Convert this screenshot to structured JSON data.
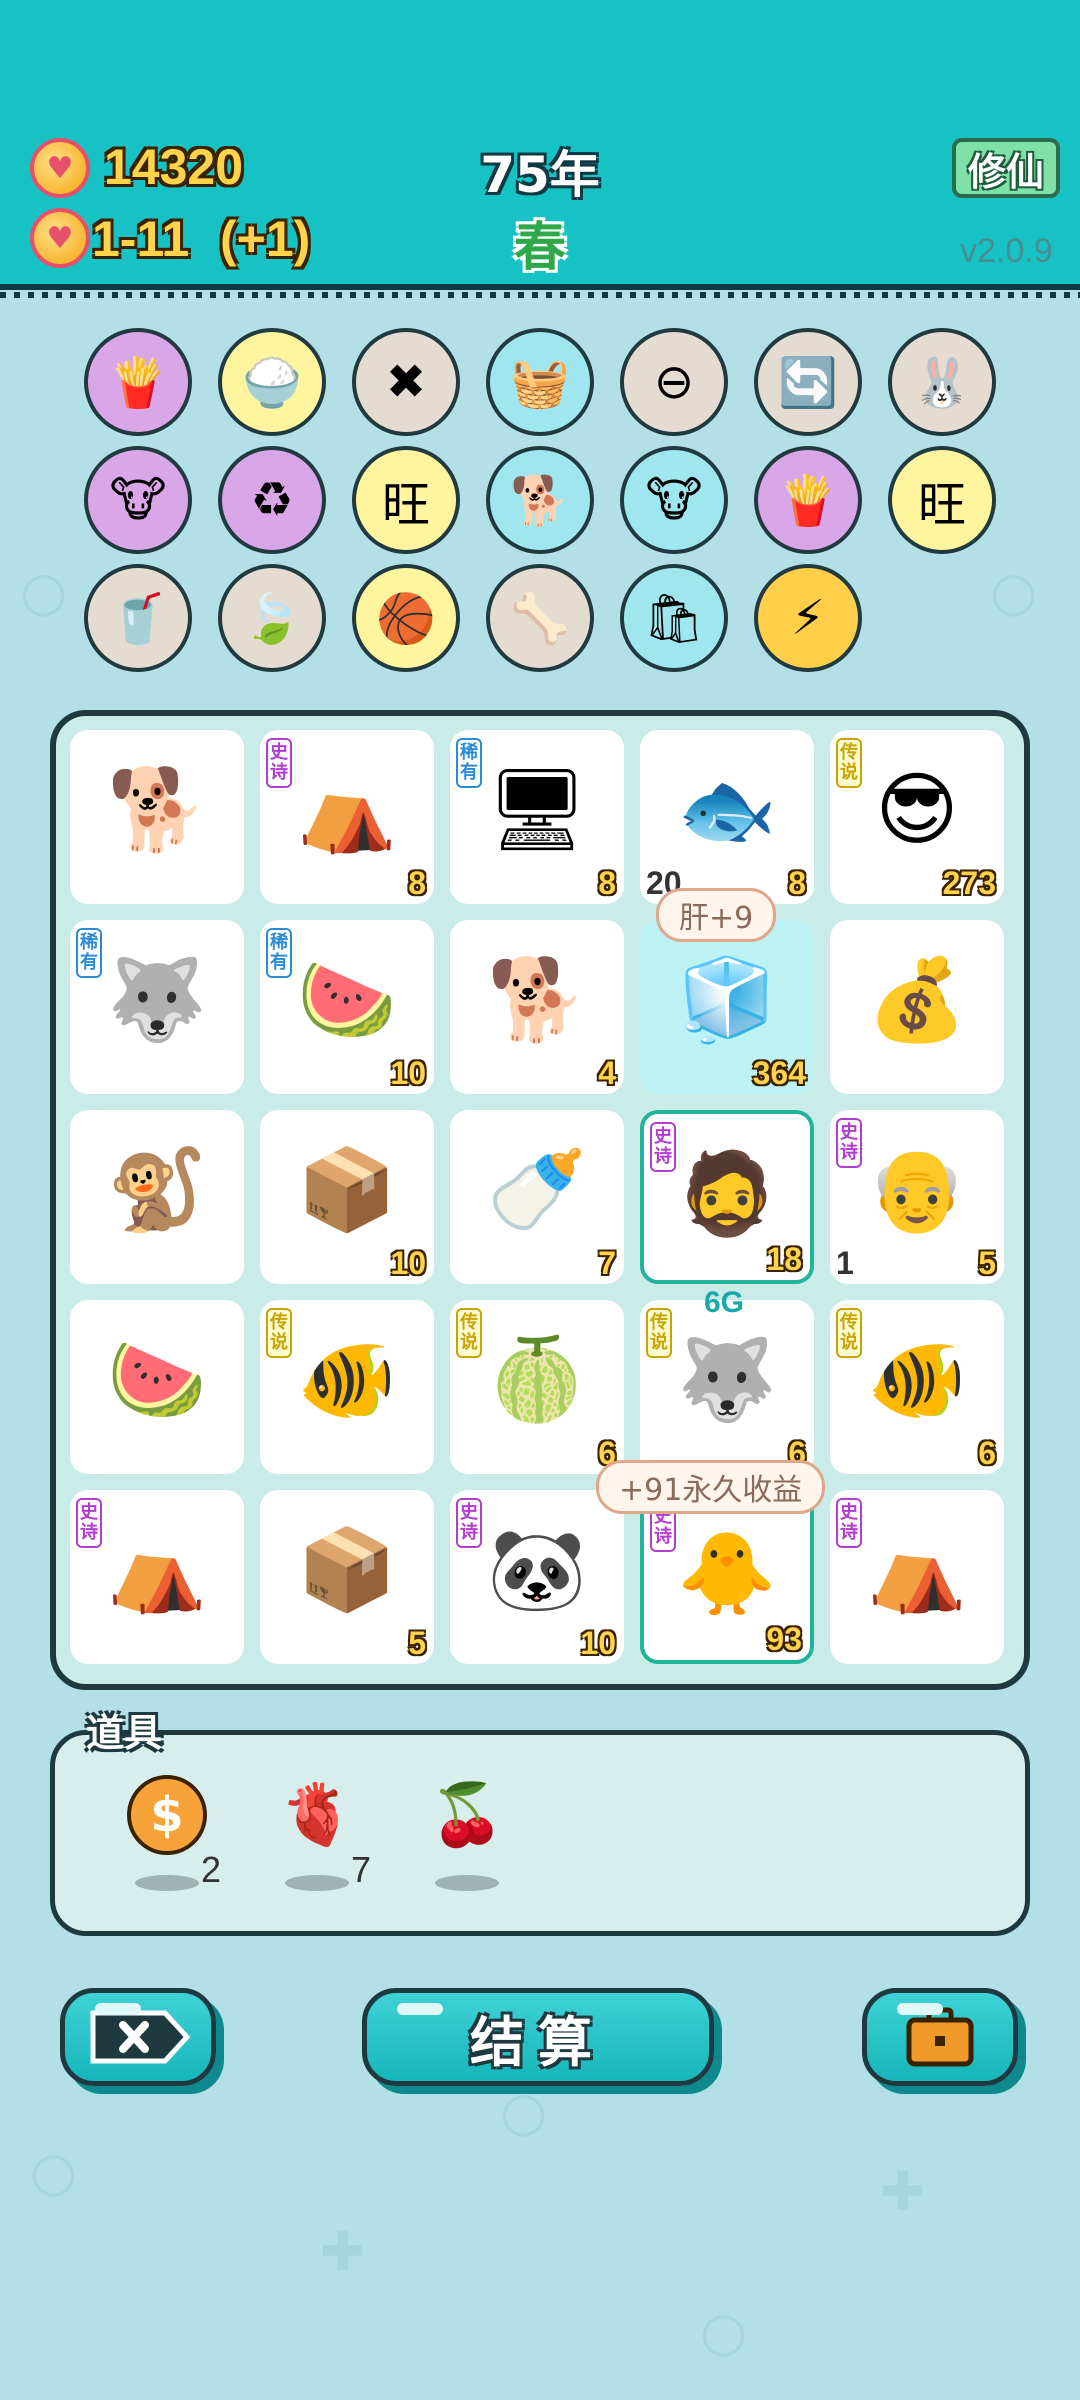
{
  "header": {
    "coins": "14320",
    "income": "1-11",
    "income_delta": "(+1)",
    "year": "75年",
    "season": "春",
    "xiuxian_label": "修仙",
    "version": "v2.0.9"
  },
  "skills": [
    {
      "icon": "fries-icon",
      "glyph": "🍟",
      "color": "purple"
    },
    {
      "icon": "rice-bowl-icon",
      "glyph": "🍚",
      "color": "yellow"
    },
    {
      "icon": "delete-tag-icon",
      "glyph": "✖",
      "color": "grey"
    },
    {
      "icon": "fruit-basket-icon",
      "glyph": "🧺",
      "color": "cyan"
    },
    {
      "icon": "minus-circle-icon",
      "glyph": "⊖",
      "color": "grey"
    },
    {
      "icon": "refresh-icon",
      "glyph": "🔄",
      "color": "grey"
    },
    {
      "icon": "rabbit-icon",
      "glyph": "🐰",
      "color": "grey"
    },
    {
      "icon": "twin-cow-icon",
      "glyph": "🐮",
      "color": "purple"
    },
    {
      "icon": "recycle-icon",
      "glyph": "♻",
      "color": "purple"
    },
    {
      "icon": "wang-chars-icon",
      "glyph": "旺",
      "color": "yellow"
    },
    {
      "icon": "cool-dog-icon",
      "glyph": "🐕",
      "color": "cyan"
    },
    {
      "icon": "twin-cow-icon",
      "glyph": "🐮",
      "color": "cyan"
    },
    {
      "icon": "fries-icon",
      "glyph": "🍟",
      "color": "purple"
    },
    {
      "icon": "wang-chars-icon",
      "glyph": "旺",
      "color": "yellow"
    },
    {
      "icon": "milk-tea-icon",
      "glyph": "🥤",
      "color": "grey"
    },
    {
      "icon": "leaf-icon",
      "glyph": "🍃",
      "color": "grey"
    },
    {
      "icon": "basketballs-icon",
      "glyph": "🏀",
      "color": "yellow"
    },
    {
      "icon": "dog-food-icon",
      "glyph": "🦴",
      "color": "grey"
    },
    {
      "icon": "trash-bag-icon",
      "glyph": "🛍",
      "color": "cyan"
    },
    {
      "icon": "lightning-icon",
      "glyph": "⚡",
      "color": "orange"
    }
  ],
  "tags": {
    "epic": "史诗",
    "rare": "稀有",
    "legend": "传说"
  },
  "board": [
    {
      "name": "husky-dog",
      "glyph": "🐕",
      "tag": "",
      "num": "",
      "numL": ""
    },
    {
      "name": "rabbit-tent",
      "glyph": "⛺",
      "tag": "epic",
      "num": "8",
      "numL": ""
    },
    {
      "name": "pc-tower",
      "glyph": "🖥",
      "tag": "rare",
      "num": "8",
      "numL": ""
    },
    {
      "name": "fish",
      "glyph": "🐟",
      "tag": "",
      "num": "8",
      "numL": "20"
    },
    {
      "name": "sunglasses-man",
      "glyph": "😎",
      "tag": "legend",
      "num": "273",
      "numL": ""
    },
    {
      "name": "husky-grey",
      "glyph": "🐺",
      "tag": "rare",
      "num": "",
      "numL": ""
    },
    {
      "name": "watermelon-slice",
      "glyph": "🍉",
      "tag": "rare",
      "num": "10",
      "numL": ""
    },
    {
      "name": "husky-dog",
      "glyph": "🐕",
      "tag": "",
      "num": "4",
      "numL": ""
    },
    {
      "name": "fridge",
      "glyph": "🧊",
      "tag": "",
      "num": "364",
      "numL": ""
    },
    {
      "name": "coin-pile",
      "glyph": "💰",
      "tag": "",
      "num": "",
      "numL": ""
    },
    {
      "name": "monkey",
      "glyph": "🐒",
      "tag": "",
      "num": "",
      "numL": ""
    },
    {
      "name": "parcel-box",
      "glyph": "📦",
      "tag": "",
      "num": "10",
      "numL": ""
    },
    {
      "name": "milk-bottle",
      "glyph": "🍼",
      "tag": "",
      "num": "7",
      "numL": ""
    },
    {
      "name": "green-hat-man",
      "glyph": "🧔",
      "tag": "epic",
      "num": "18",
      "numL": ""
    },
    {
      "name": "old-man",
      "glyph": "👴",
      "tag": "epic",
      "num": "5",
      "numL": "1"
    },
    {
      "name": "watermelon-slice",
      "glyph": "🍉",
      "tag": "",
      "num": "",
      "numL": ""
    },
    {
      "name": "koi-fish",
      "glyph": "🐠",
      "tag": "legend",
      "num": "",
      "numL": ""
    },
    {
      "name": "watermelon",
      "glyph": "🍈",
      "tag": "legend",
      "num": "6",
      "numL": ""
    },
    {
      "name": "husky-king",
      "glyph": "🐺",
      "tag": "legend",
      "num": "6",
      "numL": ""
    },
    {
      "name": "koi-fish",
      "glyph": "🐠",
      "tag": "legend",
      "num": "6",
      "numL": ""
    },
    {
      "name": "rabbit-tent",
      "glyph": "⛺",
      "tag": "epic",
      "num": "",
      "numL": ""
    },
    {
      "name": "parcel-box",
      "glyph": "📦",
      "tag": "",
      "num": "5",
      "numL": ""
    },
    {
      "name": "panda",
      "glyph": "🐼",
      "tag": "epic",
      "num": "10",
      "numL": ""
    },
    {
      "name": "chick-man",
      "glyph": "🐥",
      "tag": "epic",
      "num": "93",
      "numL": ""
    },
    {
      "name": "rabbit-tent",
      "glyph": "⛺",
      "tag": "epic",
      "num": "",
      "numL": ""
    }
  ],
  "bubbles": {
    "liver": "肝+9",
    "permanent": "+91永久收益",
    "g6": "6G"
  },
  "items": {
    "title": "道具",
    "list": [
      {
        "icon": "dollar-coin-icon",
        "glyph": "$",
        "count": "2"
      },
      {
        "icon": "liver-icon",
        "glyph": "🫀",
        "count": "7"
      },
      {
        "icon": "lychee-icon",
        "glyph": "🍒",
        "count": ""
      }
    ]
  },
  "buttons": {
    "settle": "结算"
  }
}
